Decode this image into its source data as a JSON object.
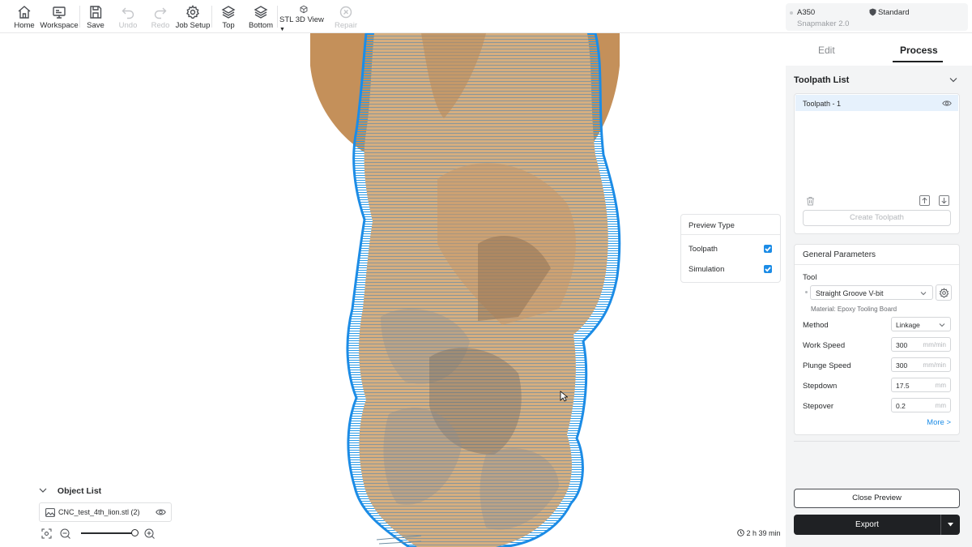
{
  "toolbar": {
    "items": [
      {
        "label": "Home",
        "icon": "home-icon",
        "enabled": true
      },
      {
        "label": "Workspace",
        "icon": "workspace-icon",
        "enabled": true
      },
      {
        "label": "Save",
        "icon": "save-icon",
        "enabled": true
      },
      {
        "label": "Undo",
        "icon": "undo-icon",
        "enabled": false
      },
      {
        "label": "Redo",
        "icon": "redo-icon",
        "enabled": false
      },
      {
        "label": "Job Setup",
        "icon": "gear-icon",
        "enabled": true
      },
      {
        "label": "Top",
        "icon": "layers-icon",
        "enabled": true
      },
      {
        "label": "Bottom",
        "icon": "layers-bottom-icon",
        "enabled": true
      },
      {
        "label": "STL 3D View",
        "icon": "cube-icon",
        "enabled": true
      },
      {
        "label": "Repair",
        "icon": "repair-icon",
        "enabled": false
      }
    ]
  },
  "machine": {
    "model": "A350",
    "name": "Snapmaker 2.0",
    "profile": "Standard"
  },
  "preview": {
    "title": "Preview Type",
    "toolpath_label": "Toolpath",
    "toolpath_checked": true,
    "simulation_label": "Simulation",
    "simulation_checked": true
  },
  "object_list": {
    "title": "Object List",
    "file": "CNC_test_4th_lion.stl (2)"
  },
  "zoom": {
    "level": 0.95
  },
  "estimated_time": "2 h 39 min",
  "right_panel": {
    "tabs": {
      "edit": "Edit",
      "process": "Process"
    },
    "toolpath_list_title": "Toolpath List",
    "toolpath_item": "Toolpath - 1",
    "create_toolpath": "Create Toolpath",
    "general_params_title": "General Parameters",
    "tool_label": "Tool",
    "tool_value": "Straight Groove V-bit",
    "material": "Material: Epoxy Tooling Board",
    "params": [
      {
        "label": "Method",
        "value": "Linkage",
        "unit": ""
      },
      {
        "label": "Work Speed",
        "value": "300",
        "unit": "mm/min"
      },
      {
        "label": "Plunge Speed",
        "value": "300",
        "unit": "mm/min"
      },
      {
        "label": "Stepdown",
        "value": "17.5",
        "unit": "mm"
      },
      {
        "label": "Stepover",
        "value": "0.2",
        "unit": "mm"
      }
    ],
    "more": "More >",
    "close_preview": "Close Preview",
    "export": "Export"
  },
  "colors": {
    "accent": "#1c8ce6",
    "model": "#d2a877",
    "toolpath": "#2b9be8",
    "dark_button": "#1f2124"
  }
}
